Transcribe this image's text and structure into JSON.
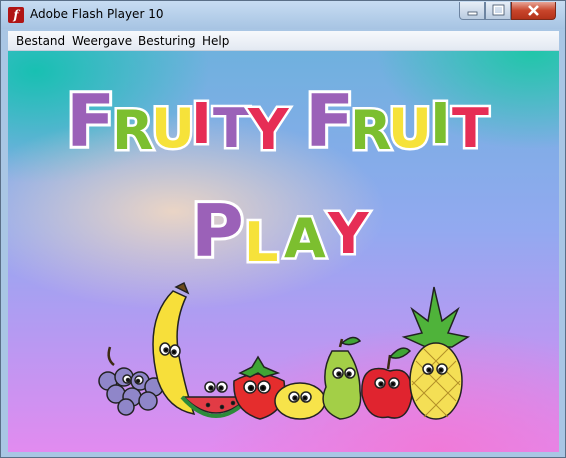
{
  "window": {
    "title": "Adobe Flash Player 10",
    "app_icon": "flash-icon"
  },
  "menu": {
    "items": [
      "Bestand",
      "Weergave",
      "Besturing",
      "Help"
    ]
  },
  "game": {
    "title_line1": "Fruity Fruit",
    "play_label": "Play",
    "title_letters_1": [
      "F",
      "R",
      "U",
      "I",
      "T",
      "Y"
    ],
    "title_letters_2": [
      "F",
      "R",
      "U",
      "I",
      "T"
    ],
    "play_letters": [
      "P",
      "L",
      "A",
      "Y"
    ],
    "colors": {
      "purple": "#9b61b8",
      "green": "#7cbf2f",
      "yellow": "#f6e23a",
      "red": "#e62d55"
    }
  }
}
